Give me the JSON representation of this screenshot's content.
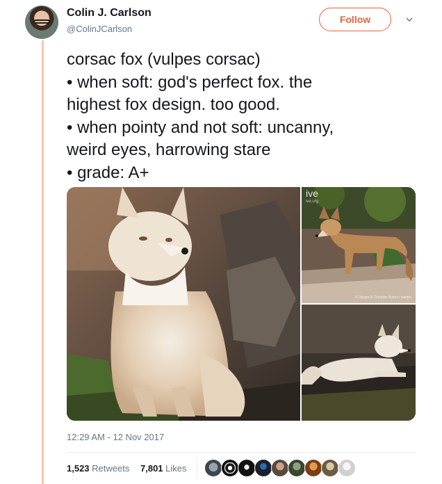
{
  "author": {
    "name": "Colin J. Carlson",
    "handle": "@ColinJCarlson"
  },
  "follow_label": "Follow",
  "tweet_lines": [
    "corsac fox (vulpes corsac)",
    "• when soft: god's perfect fox. the",
    "highest fox design. too good.",
    "• when pointy and not soft: uncanny,",
    "weird eyes, harrowing stare",
    "• grade: A+"
  ],
  "media": {
    "watermark_top": "ive",
    "watermark_top_sub": "ive.org",
    "photo_credit": "© Jürgen & Christine Sohns / wwfpix"
  },
  "timestamp": "12:29 AM - 12 Nov 2017",
  "stats": {
    "retweets_count": "1,523",
    "retweets_label": "Retweets",
    "likes_count": "7,801",
    "likes_label": "Likes"
  },
  "colors": {
    "accent": "#e8613c",
    "thread_line": "#f5c6b4",
    "secondary_text": "#657786"
  },
  "icons": {
    "chevron": "chevron-down-icon"
  }
}
